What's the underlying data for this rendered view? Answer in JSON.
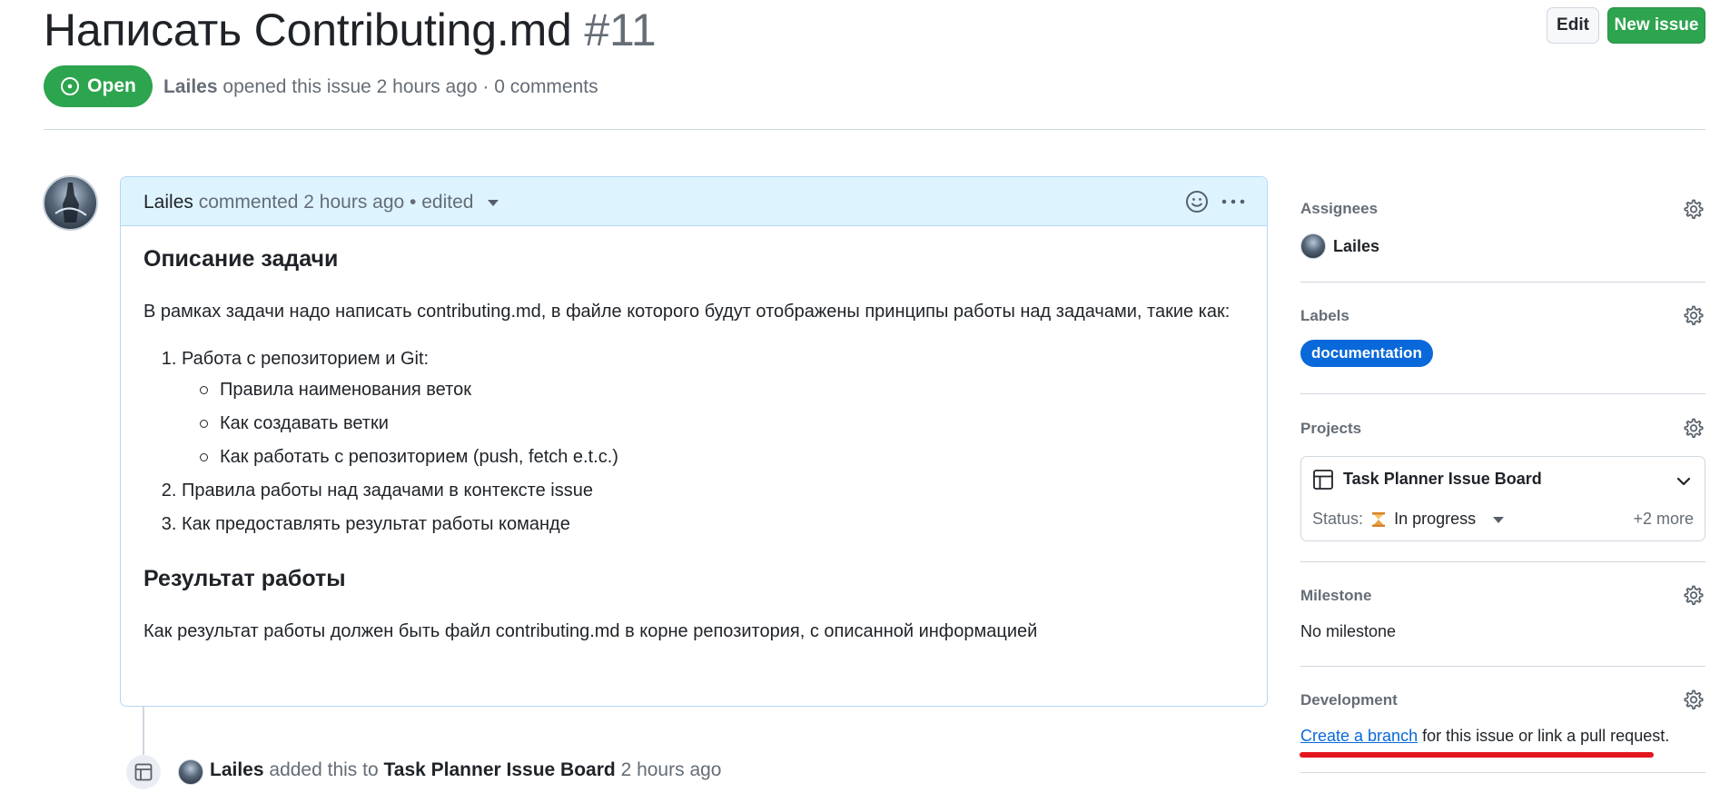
{
  "issue": {
    "title": "Написать Contributing.md",
    "number": "#11",
    "state": "Open",
    "author": "Lailes",
    "meta_rest": "opened this issue 2 hours ago · 0 comments"
  },
  "header_buttons": {
    "edit": "Edit",
    "new_issue": "New issue"
  },
  "comment": {
    "author": "Lailes",
    "meta": "commented 2 hours ago • edited",
    "body": {
      "heading1": "Описание задачи",
      "paragraph1": "В рамках задачи надо написать contributing.md, в файле которого будут отображены принципы работы над задачами, такие как:",
      "list": [
        {
          "text": "Работа с репозиторием и Git:",
          "sub": [
            "Правила наименования веток",
            "Как создавать ветки",
            "Как работать с репозиторием (push, fetch e.t.c.)"
          ]
        },
        {
          "text": "Правила работы над задачами в контексте issue"
        },
        {
          "text": "Как предоставлять результат работы команде"
        }
      ],
      "heading2": "Результат работы",
      "paragraph2": "Как результат работы должен быть файл contributing.md в корне репозитория, с описанной информацией"
    }
  },
  "event": {
    "author": "Lailes",
    "action": "added this to",
    "target": "Task Planner Issue Board",
    "time": "2 hours ago"
  },
  "sidebar": {
    "assignees": {
      "label": "Assignees",
      "user": "Lailes"
    },
    "labels": {
      "label": "Labels",
      "items": [
        "documentation"
      ]
    },
    "projects": {
      "label": "Projects",
      "project_name": "Task Planner Issue Board",
      "status_label": "Status:",
      "status_value": "In progress",
      "more": "+2 more"
    },
    "milestone": {
      "label": "Milestone",
      "value": "No milestone"
    },
    "development": {
      "label": "Development",
      "link_text": "Create a branch",
      "rest_text": "for this issue or link a pull request."
    }
  },
  "colors": {
    "open_green": "#2da44e",
    "label_blue": "#0969da",
    "comment_header_bg": "#ddf4ff",
    "annotation_red": "#e3161d"
  }
}
